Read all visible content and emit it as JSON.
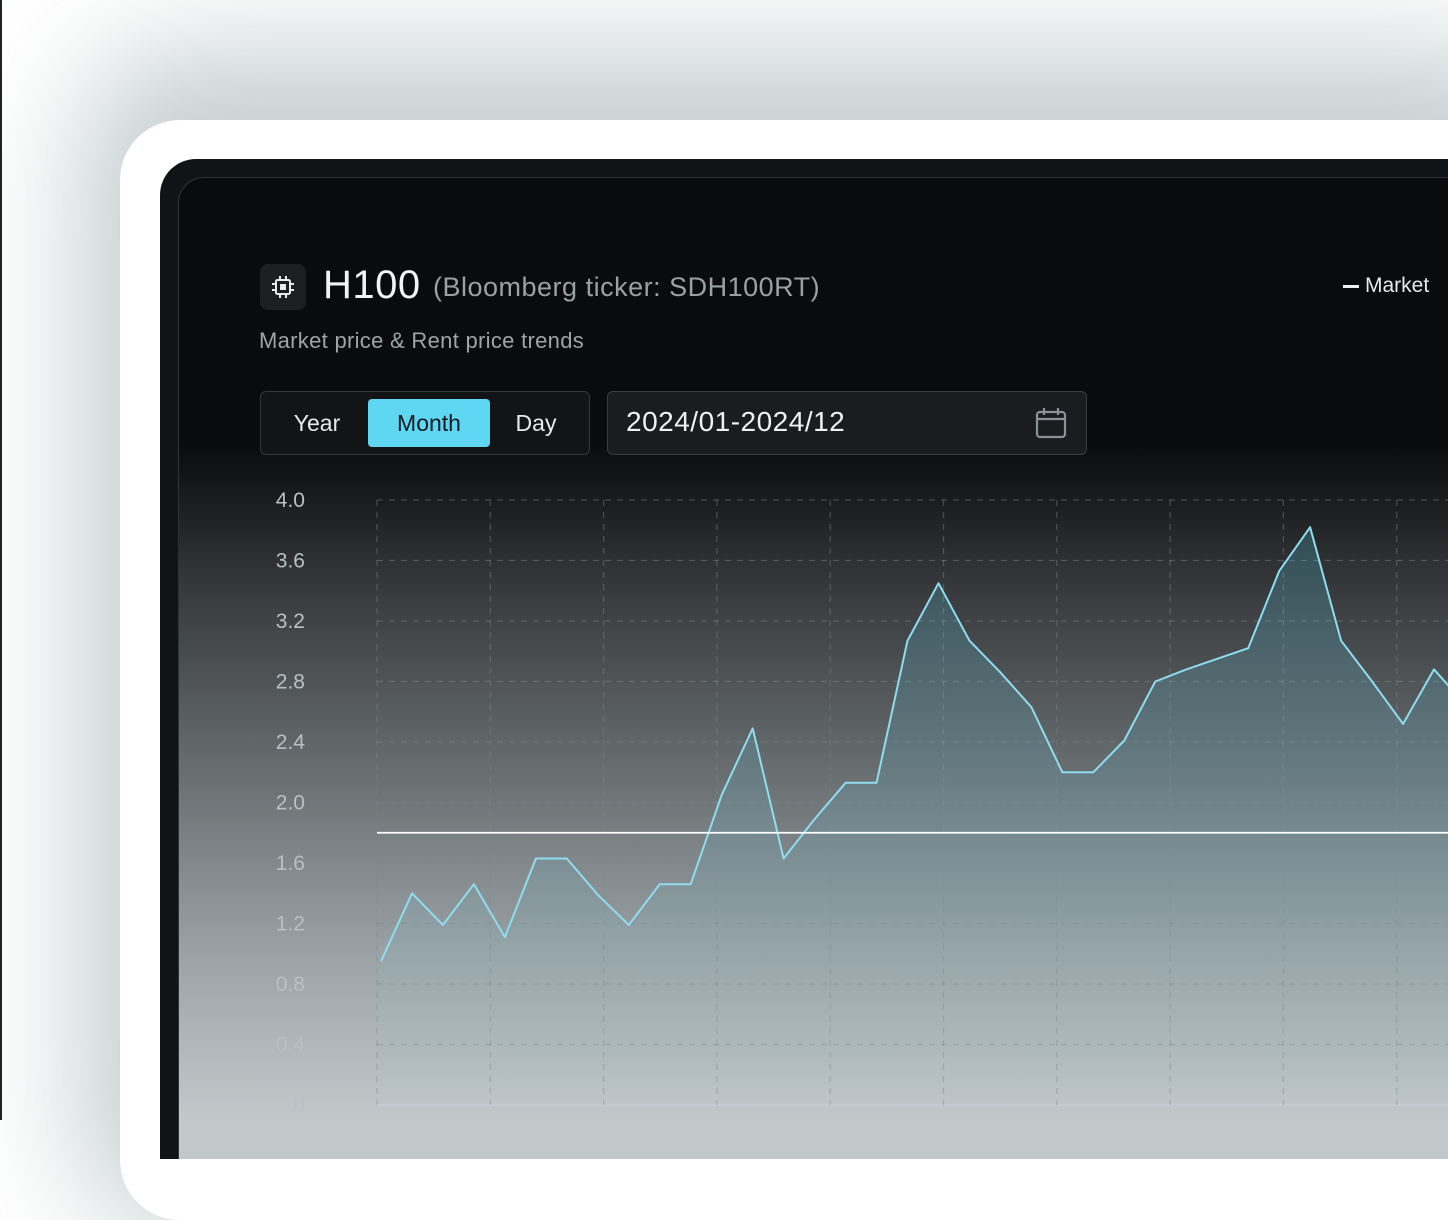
{
  "header": {
    "title": "H100",
    "ticker": "(Bloomberg ticker: SDH100RT)",
    "subtitle": "Market price & Rent price trends",
    "legend_label": "Market"
  },
  "period_toggle": {
    "options": [
      "Year",
      "Month",
      "Day"
    ],
    "selected": "Month"
  },
  "date_range": {
    "value": "2024/01-2024/12"
  },
  "icons": {
    "chip": "cpu-chip-icon",
    "calendar": "calendar-icon"
  },
  "colors": {
    "accent": "#5fd6f2",
    "series_line": "#8fdcef",
    "reference_line": "#ffffff"
  },
  "chart_data": {
    "type": "area",
    "y_ticks": [
      "4.0",
      "3.6",
      "3.2",
      "2.8",
      "2.4",
      "2.0",
      "1.6",
      "1.2",
      "0.8",
      "0.4",
      "0"
    ],
    "ylim": [
      0,
      4.0
    ],
    "grid": true,
    "legend_position": "top-right",
    "series": [
      {
        "name": "Market",
        "values": [
          0.95,
          1.4,
          1.19,
          1.46,
          1.11,
          1.63,
          1.63,
          1.39,
          1.19,
          1.46,
          1.46,
          2.05,
          2.49,
          1.63,
          1.89,
          2.13,
          2.13,
          3.07,
          3.45,
          3.07,
          2.86,
          2.63,
          2.2,
          2.2,
          2.41,
          2.8,
          2.88,
          2.95,
          3.02,
          3.53,
          3.82,
          3.07,
          2.8,
          2.52,
          2.88,
          2.65
        ],
        "reference": 1.8
      }
    ]
  }
}
